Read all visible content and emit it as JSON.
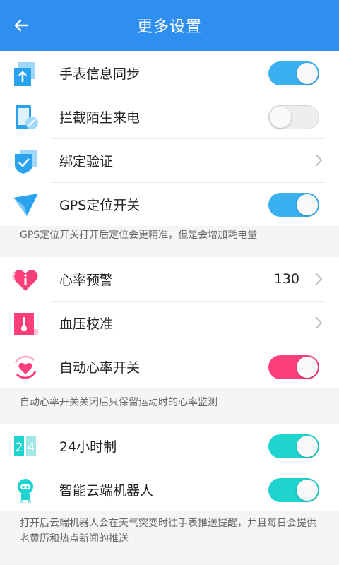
{
  "header": {
    "title": "更多设置"
  },
  "group1": [
    {
      "label": "手表信息同步",
      "icon": "sync-icon",
      "toggle": "on",
      "color": "#3ab0f0"
    },
    {
      "label": "拦截陌生来电",
      "icon": "phone-block-icon",
      "toggle": "off"
    },
    {
      "label": "绑定验证",
      "icon": "shield-check-icon",
      "chevron": true
    },
    {
      "label": "GPS定位开关",
      "icon": "gps-arrow-icon",
      "toggle": "on",
      "color": "#3ab0f0"
    }
  ],
  "note1": "GPS定位开关打开后定位会更精准，但是会增加耗电量",
  "group2": [
    {
      "label": "心率预警",
      "icon": "heart-alert-icon",
      "value": "130",
      "chevron": true
    },
    {
      "label": "血压校准",
      "icon": "thermometer-icon",
      "chevron": true
    },
    {
      "label": "自动心率开关",
      "icon": "heart-rate-icon",
      "toggle": "on",
      "color": "#fa3f7a"
    }
  ],
  "note2": "自动心率开关关闭后只保留运动时的心率监测",
  "group3": [
    {
      "label": "24小时制",
      "icon": "clock-24-icon",
      "toggle": "on",
      "color": "#1fd3cf"
    },
    {
      "label": "智能云端机器人",
      "icon": "robot-icon",
      "toggle": "on",
      "color": "#1fd3cf"
    }
  ],
  "note3": "打开后云端机器人会在天气突变时往手表推送提醒，并且每日会提供老黄历和热点新闻的推送",
  "colors": {
    "header": "#2f8ff0",
    "blue_toggle": "#3ab0f0",
    "pink_toggle": "#fa3f7a",
    "cyan_toggle": "#1fd3cf"
  }
}
